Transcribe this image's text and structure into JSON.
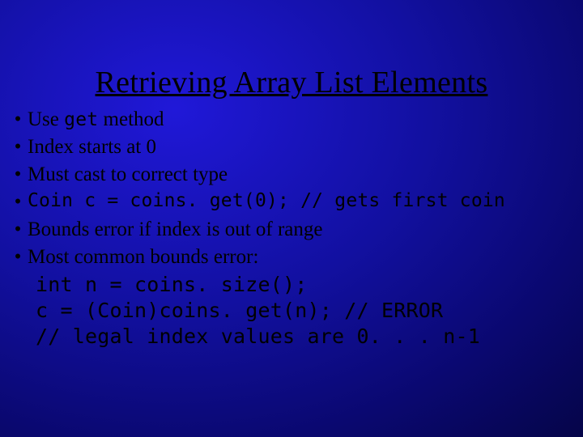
{
  "title": "Retrieving Array List Elements",
  "bullets": [
    {
      "pre": "Use ",
      "code": "get",
      "post": " method"
    },
    {
      "text": "Index starts at 0"
    },
    {
      "text": "Must cast to correct type"
    },
    {
      "codeonly": "Coin c = coins. get(0); // gets first coin"
    },
    {
      "text": "Bounds error if index is out of range"
    },
    {
      "text": "Most common bounds error:"
    }
  ],
  "sublines": [
    "int n = coins. size();",
    "c = (Coin)coins. get(n); // ERROR",
    "// legal index values are 0. . . n-1"
  ]
}
